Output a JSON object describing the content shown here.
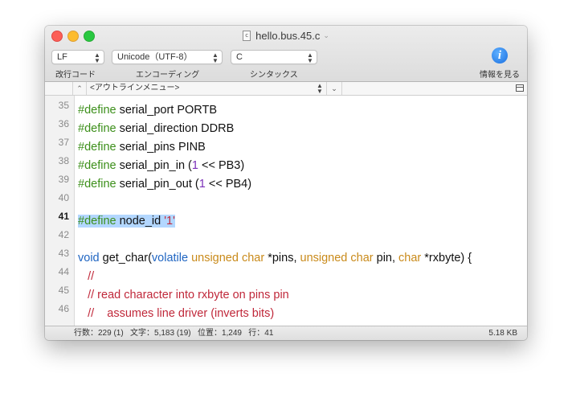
{
  "window": {
    "title": "hello.bus.45.c",
    "doc_icon_letter": "c"
  },
  "toolbar": {
    "line_ending": {
      "value": "LF",
      "label": "改行コード"
    },
    "encoding": {
      "value": "Unicode（UTF-8）",
      "label": "エンコーディング"
    },
    "syntax": {
      "value": "C",
      "label": "シンタックス"
    },
    "info": {
      "icon_letter": "i",
      "label": "情報を見る"
    }
  },
  "navbar": {
    "outline_menu": "<アウトラインメニュー>"
  },
  "editor": {
    "line_numbers": [
      "35",
      "36",
      "37",
      "38",
      "39",
      "40",
      "41",
      "42",
      "43",
      "44",
      "45",
      "46"
    ],
    "current_line": "41",
    "lines": [
      {
        "pp": "#define",
        "rest": " serial_port PORTB"
      },
      {
        "pp": "#define",
        "rest": " serial_direction DDRB"
      },
      {
        "pp": "#define",
        "rest": " serial_pins PINB"
      },
      {
        "pp": "#define",
        "a": " serial_pin_in (",
        "num": "1",
        "b": " << PB3)"
      },
      {
        "pp": "#define",
        "a": " serial_pin_out (",
        "num": "1",
        "b": " << PB4)"
      },
      {
        "pp": "#define",
        "a": " node_id ",
        "str": "'1'"
      },
      {
        "kw1": "void",
        "t1": " get_char(",
        "kw2": "volatile",
        "t2": " ",
        "ty1": "unsigned char",
        "t3": " *pins, ",
        "ty2": "unsigned char",
        "t4": " pin, ",
        "ty3": "char",
        "t5": " *rxbyte) {"
      },
      {
        "cm": "   //"
      },
      {
        "cm": "   // read character into rxbyte on pins pin"
      },
      {
        "cm": "   //    assumes line driver (inverts bits)"
      }
    ]
  },
  "status": {
    "left": "行数：229 (1)   文字：5,183 (19)   位置：1,249   行：41",
    "right": "5.18 KB"
  }
}
